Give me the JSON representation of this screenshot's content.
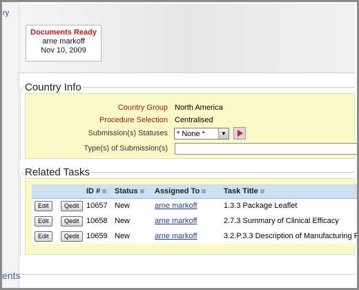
{
  "left_rail": {
    "top_link": "ry",
    "bottom_link": "ents"
  },
  "status_card": {
    "title": "Documents Ready",
    "user": "arne markoff",
    "date": "Nov 10, 2009"
  },
  "country_info": {
    "title": "Country Info",
    "country_group_label": "Country Group",
    "country_group_value": "North America",
    "procedure_label": "Procedure Selection",
    "procedure_value": "Centralised",
    "statuses_label": "Submission(s) Statuses",
    "statuses_value": "* None *",
    "types_label": "Type(s) of Submission(s)",
    "types_value": ""
  },
  "related_tasks": {
    "title": "Related Tasks",
    "columns": [
      "",
      "",
      "ID #",
      "Status",
      "Assigned To",
      "Task Title"
    ],
    "edit_label": "Edit",
    "qedit_label": "Qedit",
    "rows": [
      {
        "id": "10657",
        "status": "New",
        "assigned": "arne markoff",
        "title": "1.3.3 Package Leaflet"
      },
      {
        "id": "10658",
        "status": "New",
        "assigned": "arne markoff",
        "title": "2.7.3 Summary of Clinical Efficacy"
      },
      {
        "id": "10659",
        "status": "New",
        "assigned": "arne markoff",
        "title": "3.2.P.3.3 Description of Manufacturing P"
      }
    ]
  },
  "colors": {
    "accent_red": "#c21818",
    "panel_yellow": "#fafac8",
    "header_blue": "#cde0f2",
    "link_blue": "#1d3e9a"
  }
}
